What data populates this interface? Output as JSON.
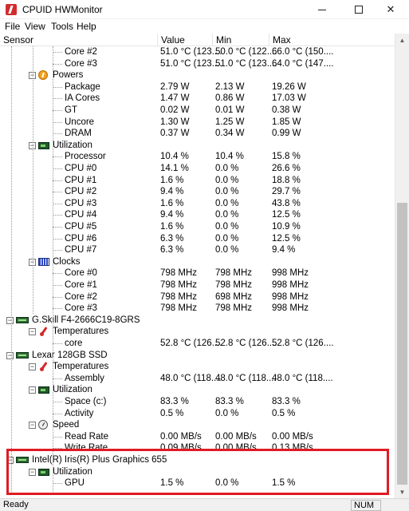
{
  "window": {
    "title": "CPUID HWMonitor"
  },
  "menu": [
    "File",
    "View",
    "Tools",
    "Help"
  ],
  "columns": {
    "sensor": "Sensor",
    "value": "Value",
    "min": "Min",
    "max": "Max"
  },
  "rows": [
    {
      "label": "Core #2",
      "value": "51.0 °C (123....",
      "min": "50.0 °C (122....",
      "max": "66.0 °C (150...."
    },
    {
      "label": "Core #3",
      "value": "51.0 °C (123....",
      "min": "51.0 °C (123....",
      "max": "64.0 °C (147...."
    },
    {
      "label": "Powers",
      "value": "",
      "min": "",
      "max": ""
    },
    {
      "label": "Package",
      "value": "2.79 W",
      "min": "2.13 W",
      "max": "19.26 W"
    },
    {
      "label": "IA Cores",
      "value": "1.47 W",
      "min": "0.86 W",
      "max": "17.03 W"
    },
    {
      "label": "GT",
      "value": "0.02 W",
      "min": "0.01 W",
      "max": "0.38 W"
    },
    {
      "label": "Uncore",
      "value": "1.30 W",
      "min": "1.25 W",
      "max": "1.85 W"
    },
    {
      "label": "DRAM",
      "value": "0.37 W",
      "min": "0.34 W",
      "max": "0.99 W"
    },
    {
      "label": "Utilization",
      "value": "",
      "min": "",
      "max": ""
    },
    {
      "label": "Processor",
      "value": "10.4 %",
      "min": "10.4 %",
      "max": "15.8 %"
    },
    {
      "label": "CPU #0",
      "value": "14.1 %",
      "min": "0.0 %",
      "max": "26.6 %"
    },
    {
      "label": "CPU #1",
      "value": "1.6 %",
      "min": "0.0 %",
      "max": "18.8 %"
    },
    {
      "label": "CPU #2",
      "value": "9.4 %",
      "min": "0.0 %",
      "max": "29.7 %"
    },
    {
      "label": "CPU #3",
      "value": "1.6 %",
      "min": "0.0 %",
      "max": "43.8 %"
    },
    {
      "label": "CPU #4",
      "value": "9.4 %",
      "min": "0.0 %",
      "max": "12.5 %"
    },
    {
      "label": "CPU #5",
      "value": "1.6 %",
      "min": "0.0 %",
      "max": "10.9 %"
    },
    {
      "label": "CPU #6",
      "value": "6.3 %",
      "min": "0.0 %",
      "max": "12.5 %"
    },
    {
      "label": "CPU #7",
      "value": "6.3 %",
      "min": "0.0 %",
      "max": "9.4 %"
    },
    {
      "label": "Clocks",
      "value": "",
      "min": "",
      "max": ""
    },
    {
      "label": "Core #0",
      "value": "798 MHz",
      "min": "798 MHz",
      "max": "998 MHz"
    },
    {
      "label": "Core #1",
      "value": "798 MHz",
      "min": "798 MHz",
      "max": "998 MHz"
    },
    {
      "label": "Core #2",
      "value": "798 MHz",
      "min": "698 MHz",
      "max": "998 MHz"
    },
    {
      "label": "Core #3",
      "value": "798 MHz",
      "min": "798 MHz",
      "max": "998 MHz"
    },
    {
      "label": "G.Skill F4-2666C19-8GRS",
      "value": "",
      "min": "",
      "max": ""
    },
    {
      "label": "Temperatures",
      "value": "",
      "min": "",
      "max": ""
    },
    {
      "label": "core",
      "value": "52.8 °C (126....",
      "min": "52.8 °C (126....",
      "max": "52.8 °C (126...."
    },
    {
      "label": "Lexar 128GB SSD",
      "value": "",
      "min": "",
      "max": ""
    },
    {
      "label": "Temperatures",
      "value": "",
      "min": "",
      "max": ""
    },
    {
      "label": "Assembly",
      "value": "48.0 °C (118....",
      "min": "48.0 °C (118....",
      "max": "48.0 °C (118...."
    },
    {
      "label": "Utilization",
      "value": "",
      "min": "",
      "max": ""
    },
    {
      "label": "Space (c:)",
      "value": "83.3 %",
      "min": "83.3 %",
      "max": "83.3 %"
    },
    {
      "label": "Activity",
      "value": "0.5 %",
      "min": "0.0 %",
      "max": "0.5 %"
    },
    {
      "label": "Speed",
      "value": "",
      "min": "",
      "max": ""
    },
    {
      "label": "Read Rate",
      "value": "0.00 MB/s",
      "min": "0.00 MB/s",
      "max": "0.00 MB/s"
    },
    {
      "label": "Write Rate",
      "value": "0.09 MB/s",
      "min": "0.00 MB/s",
      "max": "0.13 MB/s"
    },
    {
      "label": "Intel(R) Iris(R) Plus Graphics 655",
      "value": "",
      "min": "",
      "max": ""
    },
    {
      "label": "Utilization",
      "value": "",
      "min": "",
      "max": ""
    },
    {
      "label": "GPU",
      "value": "1.5 %",
      "min": "0.0 %",
      "max": "1.5 %"
    }
  ],
  "status": {
    "text": "Ready",
    "num": "NUM"
  },
  "colors": {
    "highlight": "#e01b24"
  }
}
